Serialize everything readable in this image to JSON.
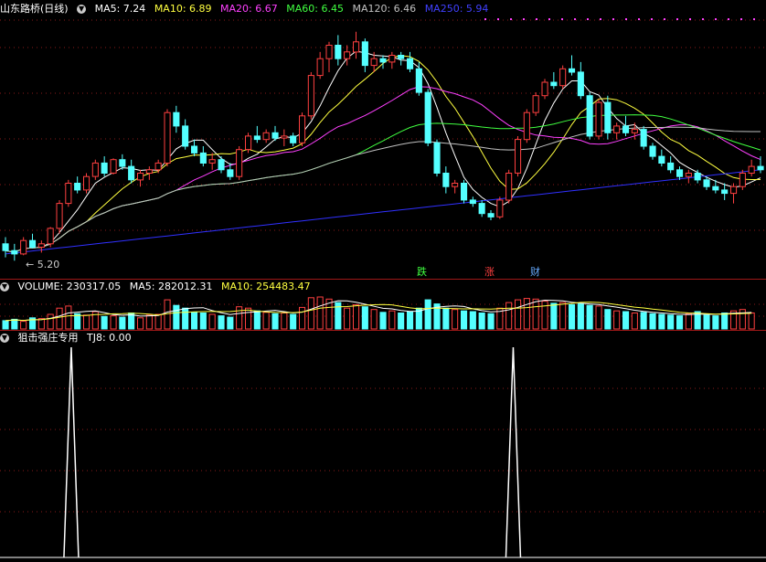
{
  "main_header": {
    "stock_name": "山东路桥(日线)",
    "ma5": "MA5: 7.24",
    "ma10": "MA10: 6.89",
    "ma20": "MA20: 6.67",
    "ma60": "MA60: 6.45",
    "ma120": "MA120: 6.46",
    "ma250": "MA250: 5.94"
  },
  "low_label": "5.20",
  "signal_tags": [
    "跌",
    "涨",
    "财"
  ],
  "volume_header": {
    "volume": "VOLUME: 230317.05",
    "ma5": "MA5: 282012.31",
    "ma10": "MA10: 254483.47"
  },
  "indicator_header": {
    "name": "狙击强庄专用",
    "tj8": "TJ8: 0.00"
  },
  "colors": {
    "up": "#ff4040",
    "down": "#54ffff",
    "ma5": "#ffffff",
    "ma10": "#ffff40",
    "ma20": "#ff40ff",
    "ma60": "#40ff40",
    "ma120": "#c0c0c0",
    "ma250": "#3030ff",
    "grid": "#8a1a1a"
  },
  "chart_data": {
    "type": "candlestick",
    "price_range": [
      5.0,
      8.8
    ],
    "candles": [
      {
        "o": 5.45,
        "h": 5.55,
        "l": 5.25,
        "c": 5.35
      },
      {
        "o": 5.35,
        "h": 5.45,
        "l": 5.2,
        "c": 5.3
      },
      {
        "o": 5.3,
        "h": 5.55,
        "l": 5.28,
        "c": 5.5
      },
      {
        "o": 5.5,
        "h": 5.6,
        "l": 5.38,
        "c": 5.4
      },
      {
        "o": 5.4,
        "h": 5.5,
        "l": 5.32,
        "c": 5.45
      },
      {
        "o": 5.45,
        "h": 5.7,
        "l": 5.4,
        "c": 5.68
      },
      {
        "o": 5.68,
        "h": 6.1,
        "l": 5.6,
        "c": 6.05
      },
      {
        "o": 6.05,
        "h": 6.4,
        "l": 6.0,
        "c": 6.35
      },
      {
        "o": 6.35,
        "h": 6.45,
        "l": 6.2,
        "c": 6.25
      },
      {
        "o": 6.25,
        "h": 6.5,
        "l": 6.2,
        "c": 6.45
      },
      {
        "o": 6.45,
        "h": 6.7,
        "l": 6.4,
        "c": 6.65
      },
      {
        "o": 6.65,
        "h": 6.75,
        "l": 6.45,
        "c": 6.5
      },
      {
        "o": 6.5,
        "h": 6.72,
        "l": 6.48,
        "c": 6.7
      },
      {
        "o": 6.7,
        "h": 6.78,
        "l": 6.55,
        "c": 6.6
      },
      {
        "o": 6.6,
        "h": 6.7,
        "l": 6.35,
        "c": 6.4
      },
      {
        "o": 6.4,
        "h": 6.55,
        "l": 6.3,
        "c": 6.5
      },
      {
        "o": 6.5,
        "h": 6.6,
        "l": 6.4,
        "c": 6.55
      },
      {
        "o": 6.55,
        "h": 6.7,
        "l": 6.5,
        "c": 6.65
      },
      {
        "o": 6.65,
        "h": 7.45,
        "l": 6.6,
        "c": 7.4
      },
      {
        "o": 7.4,
        "h": 7.5,
        "l": 7.1,
        "c": 7.2
      },
      {
        "o": 7.2,
        "h": 7.3,
        "l": 6.85,
        "c": 6.9
      },
      {
        "o": 6.9,
        "h": 7.0,
        "l": 6.75,
        "c": 6.8
      },
      {
        "o": 6.8,
        "h": 6.9,
        "l": 6.6,
        "c": 6.65
      },
      {
        "o": 6.65,
        "h": 6.8,
        "l": 6.55,
        "c": 6.7
      },
      {
        "o": 6.7,
        "h": 6.75,
        "l": 6.5,
        "c": 6.55
      },
      {
        "o": 6.55,
        "h": 6.65,
        "l": 6.4,
        "c": 6.45
      },
      {
        "o": 6.45,
        "h": 6.9,
        "l": 6.4,
        "c": 6.85
      },
      {
        "o": 6.85,
        "h": 7.1,
        "l": 6.8,
        "c": 7.05
      },
      {
        "o": 7.05,
        "h": 7.2,
        "l": 6.95,
        "c": 7.0
      },
      {
        "o": 7.0,
        "h": 7.15,
        "l": 6.95,
        "c": 7.1
      },
      {
        "o": 7.1,
        "h": 7.2,
        "l": 6.98,
        "c": 7.02
      },
      {
        "o": 7.02,
        "h": 7.15,
        "l": 6.9,
        "c": 7.05
      },
      {
        "o": 7.05,
        "h": 7.1,
        "l": 6.9,
        "c": 6.95
      },
      {
        "o": 6.95,
        "h": 7.4,
        "l": 6.9,
        "c": 7.35
      },
      {
        "o": 7.35,
        "h": 8.0,
        "l": 7.3,
        "c": 7.95
      },
      {
        "o": 7.95,
        "h": 8.3,
        "l": 7.9,
        "c": 8.2
      },
      {
        "o": 8.2,
        "h": 8.45,
        "l": 8.0,
        "c": 8.4
      },
      {
        "o": 8.4,
        "h": 8.55,
        "l": 8.1,
        "c": 8.2
      },
      {
        "o": 8.2,
        "h": 8.4,
        "l": 8.1,
        "c": 8.3
      },
      {
        "o": 8.3,
        "h": 8.6,
        "l": 8.2,
        "c": 8.45
      },
      {
        "o": 8.45,
        "h": 8.5,
        "l": 8.0,
        "c": 8.1
      },
      {
        "o": 8.1,
        "h": 8.3,
        "l": 8.0,
        "c": 8.2
      },
      {
        "o": 8.2,
        "h": 8.25,
        "l": 8.05,
        "c": 8.15
      },
      {
        "o": 8.15,
        "h": 8.3,
        "l": 8.05,
        "c": 8.25
      },
      {
        "o": 8.25,
        "h": 8.3,
        "l": 8.1,
        "c": 8.2
      },
      {
        "o": 8.2,
        "h": 8.3,
        "l": 8.0,
        "c": 8.05
      },
      {
        "o": 8.05,
        "h": 8.15,
        "l": 7.65,
        "c": 7.7
      },
      {
        "o": 7.7,
        "h": 7.75,
        "l": 6.9,
        "c": 6.95
      },
      {
        "o": 6.95,
        "h": 7.0,
        "l": 6.45,
        "c": 6.5
      },
      {
        "o": 6.5,
        "h": 6.6,
        "l": 6.2,
        "c": 6.3
      },
      {
        "o": 6.3,
        "h": 6.4,
        "l": 6.2,
        "c": 6.35
      },
      {
        "o": 6.35,
        "h": 6.4,
        "l": 6.05,
        "c": 6.1
      },
      {
        "o": 6.1,
        "h": 6.15,
        "l": 6.0,
        "c": 6.05
      },
      {
        "o": 6.05,
        "h": 6.1,
        "l": 5.85,
        "c": 5.9
      },
      {
        "o": 5.9,
        "h": 5.95,
        "l": 5.8,
        "c": 5.85
      },
      {
        "o": 5.85,
        "h": 6.15,
        "l": 5.82,
        "c": 6.1
      },
      {
        "o": 6.1,
        "h": 6.55,
        "l": 6.05,
        "c": 6.5
      },
      {
        "o": 6.5,
        "h": 7.05,
        "l": 6.45,
        "c": 7.0
      },
      {
        "o": 7.0,
        "h": 7.45,
        "l": 6.95,
        "c": 7.4
      },
      {
        "o": 7.4,
        "h": 7.7,
        "l": 7.35,
        "c": 7.65
      },
      {
        "o": 7.65,
        "h": 7.9,
        "l": 7.6,
        "c": 7.85
      },
      {
        "o": 7.85,
        "h": 8.0,
        "l": 7.75,
        "c": 7.8
      },
      {
        "o": 7.8,
        "h": 8.1,
        "l": 7.75,
        "c": 8.05
      },
      {
        "o": 8.05,
        "h": 8.25,
        "l": 7.95,
        "c": 8.0
      },
      {
        "o": 8.0,
        "h": 8.15,
        "l": 7.6,
        "c": 7.65
      },
      {
        "o": 7.65,
        "h": 7.7,
        "l": 7.0,
        "c": 7.05
      },
      {
        "o": 7.05,
        "h": 7.6,
        "l": 7.0,
        "c": 7.55
      },
      {
        "o": 7.55,
        "h": 7.65,
        "l": 7.0,
        "c": 7.1
      },
      {
        "o": 7.1,
        "h": 7.25,
        "l": 7.0,
        "c": 7.2
      },
      {
        "o": 7.2,
        "h": 7.35,
        "l": 7.05,
        "c": 7.1
      },
      {
        "o": 7.1,
        "h": 7.25,
        "l": 7.0,
        "c": 7.15
      },
      {
        "o": 7.15,
        "h": 7.2,
        "l": 6.85,
        "c": 6.9
      },
      {
        "o": 6.9,
        "h": 6.95,
        "l": 6.7,
        "c": 6.75
      },
      {
        "o": 6.75,
        "h": 6.85,
        "l": 6.6,
        "c": 6.65
      },
      {
        "o": 6.65,
        "h": 6.75,
        "l": 6.5,
        "c": 6.55
      },
      {
        "o": 6.55,
        "h": 6.6,
        "l": 6.4,
        "c": 6.45
      },
      {
        "o": 6.45,
        "h": 6.55,
        "l": 6.35,
        "c": 6.5
      },
      {
        "o": 6.5,
        "h": 6.55,
        "l": 6.35,
        "c": 6.4
      },
      {
        "o": 6.4,
        "h": 6.45,
        "l": 6.25,
        "c": 6.3
      },
      {
        "o": 6.3,
        "h": 6.4,
        "l": 6.2,
        "c": 6.25
      },
      {
        "o": 6.25,
        "h": 6.35,
        "l": 6.1,
        "c": 6.2
      },
      {
        "o": 6.2,
        "h": 6.35,
        "l": 6.05,
        "c": 6.3
      },
      {
        "o": 6.3,
        "h": 6.55,
        "l": 6.25,
        "c": 6.5
      },
      {
        "o": 6.5,
        "h": 6.7,
        "l": 6.45,
        "c": 6.6
      },
      {
        "o": 6.6,
        "h": 6.75,
        "l": 6.5,
        "c": 6.55
      }
    ],
    "volume_range": [
      0,
      500000
    ],
    "volumes": [
      120000,
      140000,
      110000,
      160000,
      150000,
      210000,
      300000,
      330000,
      220000,
      200000,
      250000,
      180000,
      190000,
      170000,
      230000,
      160000,
      200000,
      210000,
      420000,
      340000,
      300000,
      240000,
      230000,
      210000,
      190000,
      170000,
      320000,
      300000,
      260000,
      240000,
      220000,
      230000,
      210000,
      310000,
      450000,
      460000,
      430000,
      380000,
      300000,
      350000,
      320000,
      280000,
      240000,
      260000,
      230000,
      250000,
      300000,
      420000,
      360000,
      300000,
      280000,
      260000,
      250000,
      230000,
      220000,
      300000,
      380000,
      420000,
      440000,
      430000,
      400000,
      370000,
      380000,
      350000,
      360000,
      340000,
      330000,
      280000,
      260000,
      250000,
      230000,
      240000,
      220000,
      210000,
      200000,
      190000,
      220000,
      250000,
      200000,
      190000,
      230000,
      260000,
      280000,
      230317
    ]
  },
  "indicator": {
    "range": [
      0,
      1
    ],
    "peak_positions": [
      0.093,
      0.67
    ]
  }
}
